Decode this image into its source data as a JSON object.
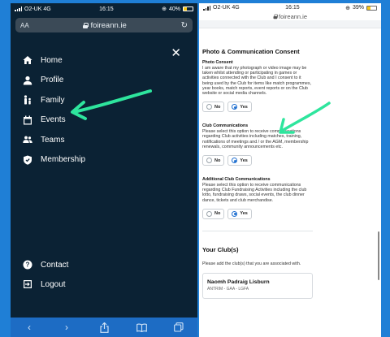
{
  "left_phone": {
    "status": {
      "carrier": "O2-UK 4G",
      "time": "16:15",
      "battery": "40%",
      "battery_level": 0.4
    },
    "address_bar": {
      "aa_label": "AA",
      "url": "foireann.ie"
    },
    "menu": {
      "items": [
        {
          "label": "Home",
          "icon": "home-icon"
        },
        {
          "label": "Profile",
          "icon": "person-icon"
        },
        {
          "label": "Family",
          "icon": "family-icon"
        },
        {
          "label": "Events",
          "icon": "calendar-icon"
        },
        {
          "label": "Teams",
          "icon": "group-icon"
        },
        {
          "label": "Membership",
          "icon": "shield-icon"
        }
      ],
      "bottom_items": [
        {
          "label": "Contact",
          "icon": "help-icon"
        },
        {
          "label": "Logout",
          "icon": "logout-icon"
        }
      ],
      "close_label": "✕"
    },
    "toolbar": {
      "back": "‹",
      "forward": "›",
      "share": "share-icon",
      "bookmarks": "book-icon",
      "tabs": "tabs-icon"
    }
  },
  "right_phone": {
    "status": {
      "carrier": "O2-UK 4G",
      "time": "16:15",
      "battery": "39%",
      "battery_level": 0.39
    },
    "url": "foireann.ie",
    "section_title": "Photo & Communication Consent",
    "photo_consent": {
      "title": "Photo Consent",
      "desc": "I am aware that my photograph or video image may be taken whilst attending or participating in games or activities connected with the Club and I consent to it being used by the Club for items like match programmes, year books, match reports, event reports or on the Club website or social media channels.",
      "options": [
        "No",
        "Yes"
      ],
      "selected": "Yes"
    },
    "club_communications": {
      "title": "Club Communications",
      "desc": "Please select this option to receive communications regarding Club activities including matches, training, notifications of meetings and / or the AGM, membership renewals, community announcements etc.",
      "options": [
        "No",
        "Yes"
      ],
      "selected": "Yes"
    },
    "additional_communications": {
      "title": "Additional Club Communications",
      "desc": "Please select this option to receive communications regarding Club Fundraising Activities including the club lotto, fundraising draws, social events, the club dinner dance, tickets and club merchandise.",
      "options": [
        "No",
        "Yes"
      ],
      "selected": "Yes"
    },
    "clubs": {
      "title": "Your Club(s)",
      "desc": "Please add the club(s) that you are associated with.",
      "club_name": "Naomh Padraig Lisburn",
      "club_meta": "ANTRIM - GAA - LGFA"
    }
  },
  "colors": {
    "background": "#1f7fd6",
    "menu_bg": "#0b2234",
    "annotation_arrow": "#2ee59d",
    "accent": "#1f6fd0"
  }
}
